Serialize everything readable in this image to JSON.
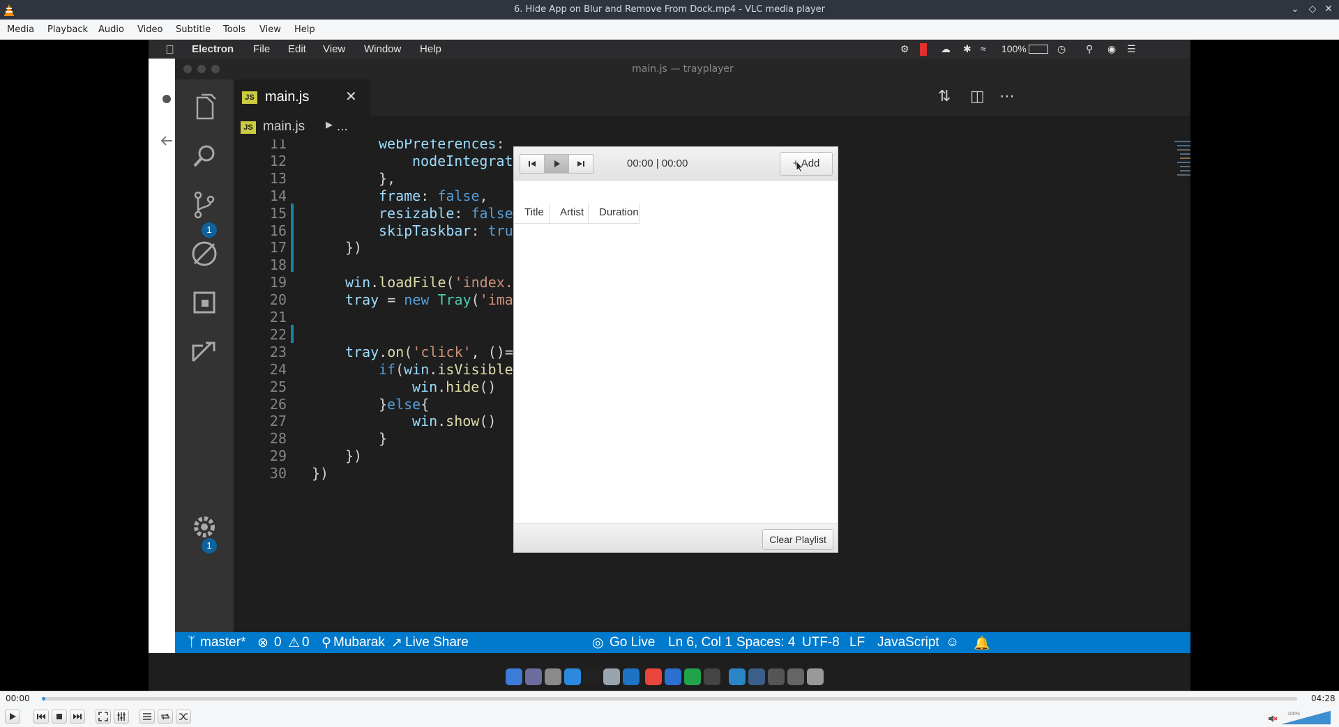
{
  "window": {
    "title": "6. Hide App on Blur and Remove From Dock.mp4 - VLC media player"
  },
  "vlc_menu": [
    "Media",
    "Playback",
    "Audio",
    "Video",
    "Subtitle",
    "Tools",
    "View",
    "Help"
  ],
  "playback": {
    "elapsed": "00:00",
    "total": "04:28",
    "progress": 0.0,
    "volume_label": "100%",
    "volume_level": 1.0,
    "muted": true
  },
  "mac": {
    "menu": [
      "Electron",
      "File",
      "Edit",
      "View",
      "Window",
      "Help"
    ],
    "battery": "100%",
    "window_title": "main.js — trayplayer"
  },
  "vscode": {
    "tab": {
      "label": "main.js",
      "icon": "JS"
    },
    "breadcrumb": {
      "file": "main.js",
      "rest": "..."
    },
    "scm_badge": "1",
    "settings_badge": "1",
    "code_lines": [
      {
        "n": "11",
        "indent": 2,
        "parts": [
          [
            "prop",
            "webPreferences"
          ],
          [
            "plain",
            ":"
          ]
        ]
      },
      {
        "n": "12",
        "indent": 3,
        "parts": [
          [
            "prop",
            "nodeIntegrat"
          ]
        ]
      },
      {
        "n": "13",
        "indent": 2,
        "parts": [
          [
            "plain",
            "},"
          ]
        ]
      },
      {
        "n": "14",
        "indent": 2,
        "parts": [
          [
            "prop",
            "frame"
          ],
          [
            "plain",
            ": "
          ],
          [
            "kw",
            "false"
          ],
          [
            "plain",
            ","
          ]
        ]
      },
      {
        "n": "15",
        "indent": 2,
        "parts": [
          [
            "prop",
            "resizable"
          ],
          [
            "plain",
            ": "
          ],
          [
            "kw",
            "false"
          ]
        ]
      },
      {
        "n": "16",
        "indent": 2,
        "parts": [
          [
            "prop",
            "skipTaskbar"
          ],
          [
            "plain",
            ": "
          ],
          [
            "kw",
            "tru"
          ]
        ]
      },
      {
        "n": "17",
        "indent": 1,
        "parts": [
          [
            "plain",
            "})"
          ]
        ]
      },
      {
        "n": "18",
        "indent": 0,
        "parts": []
      },
      {
        "n": "19",
        "indent": 1,
        "parts": [
          [
            "prop",
            "win"
          ],
          [
            "plain",
            "."
          ],
          [
            "fn",
            "loadFile"
          ],
          [
            "plain",
            "("
          ],
          [
            "str",
            "'index."
          ]
        ]
      },
      {
        "n": "20",
        "indent": 1,
        "parts": [
          [
            "prop",
            "tray"
          ],
          [
            "plain",
            " = "
          ],
          [
            "kw",
            "new"
          ],
          [
            "plain",
            " "
          ],
          [
            "cls",
            "Tray"
          ],
          [
            "plain",
            "("
          ],
          [
            "str",
            "'ima"
          ]
        ]
      },
      {
        "n": "21",
        "indent": 0,
        "parts": []
      },
      {
        "n": "22",
        "indent": 0,
        "parts": []
      },
      {
        "n": "23",
        "indent": 1,
        "parts": [
          [
            "prop",
            "tray"
          ],
          [
            "plain",
            "."
          ],
          [
            "fn",
            "on"
          ],
          [
            "plain",
            "("
          ],
          [
            "str",
            "'click'"
          ],
          [
            "plain",
            ", ()="
          ]
        ]
      },
      {
        "n": "24",
        "indent": 2,
        "parts": [
          [
            "kw",
            "if"
          ],
          [
            "plain",
            "("
          ],
          [
            "prop",
            "win"
          ],
          [
            "plain",
            "."
          ],
          [
            "fn",
            "isVisible"
          ]
        ]
      },
      {
        "n": "25",
        "indent": 3,
        "parts": [
          [
            "prop",
            "win"
          ],
          [
            "plain",
            "."
          ],
          [
            "fn",
            "hide"
          ],
          [
            "plain",
            "()"
          ]
        ]
      },
      {
        "n": "26",
        "indent": 2,
        "parts": [
          [
            "plain",
            "}"
          ],
          [
            "kw",
            "else"
          ],
          [
            "plain",
            "{"
          ]
        ]
      },
      {
        "n": "27",
        "indent": 3,
        "parts": [
          [
            "prop",
            "win"
          ],
          [
            "plain",
            "."
          ],
          [
            "fn",
            "show"
          ],
          [
            "plain",
            "()"
          ]
        ]
      },
      {
        "n": "28",
        "indent": 2,
        "parts": [
          [
            "plain",
            "}"
          ]
        ]
      },
      {
        "n": "29",
        "indent": 1,
        "parts": [
          [
            "plain",
            "})"
          ]
        ]
      },
      {
        "n": "30",
        "indent": 0,
        "parts": [
          [
            "plain",
            "})"
          ]
        ]
      }
    ],
    "status": {
      "branch": "master*",
      "errors": "0",
      "warnings": "0",
      "user": "Mubarak",
      "live_share": "Live Share",
      "go_live": "Go Live",
      "position": "Ln 6, Col 1",
      "spaces": "Spaces: 4",
      "encoding": "UTF-8",
      "eol": "LF",
      "language": "JavaScript"
    }
  },
  "player": {
    "time": "00:00 | 00:00",
    "add_label": "+ Add",
    "columns": [
      "Title",
      "Artist",
      "Duration"
    ],
    "clear_label": "Clear Playlist"
  },
  "colors": {
    "vscode_status": "#007acc",
    "vlc_seek": "#3d8fd1",
    "js_icon": "#cbcb41"
  }
}
